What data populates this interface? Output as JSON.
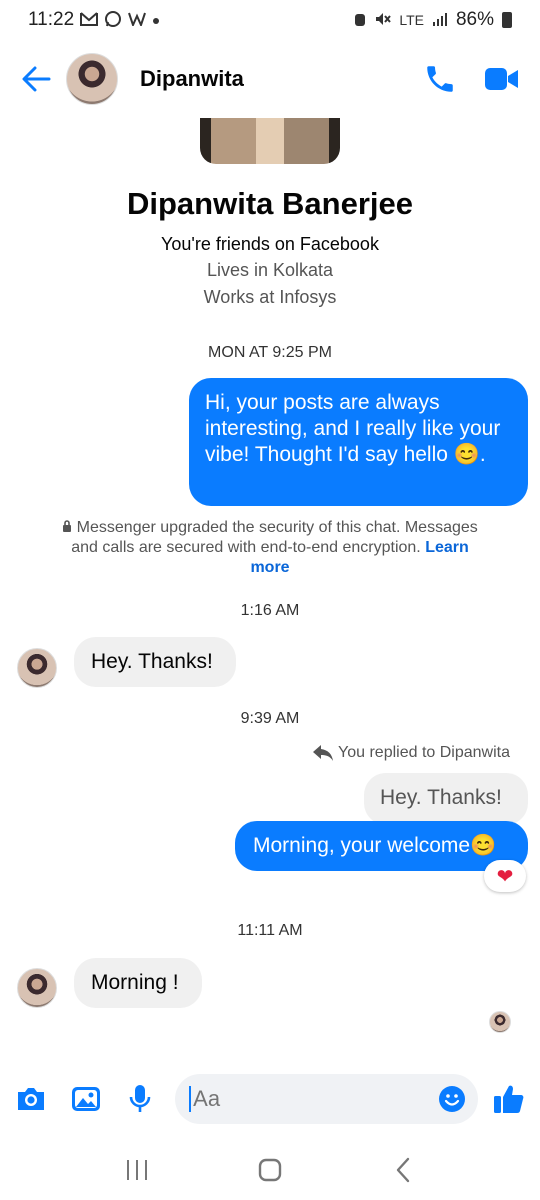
{
  "status_bar": {
    "time": "11:22",
    "left_icons": [
      "gmail-icon",
      "whatsapp-icon",
      "w-icon",
      "dot-icon"
    ],
    "right_text": "86%",
    "network": "LTE"
  },
  "header": {
    "contact_name": "Dipanwita"
  },
  "profile": {
    "full_name": "Dipanwita Banerjee",
    "friends_line": "You're friends on Facebook",
    "lives_line": "Lives in Kolkata",
    "works_line": "Works at Infosys"
  },
  "conversation": {
    "ts1": "MON AT 9:25 PM",
    "msg1": "Hi, your posts are always interesting, and I really like your vibe! Thought I'd say hello 😊.",
    "security_text": "Messenger upgraded the security of this chat. Messages and calls are secured with end-to-end encryption.",
    "learn_more": "Learn more",
    "ts2": "1:16 AM",
    "msg2": "Hey. Thanks!",
    "ts3": "9:39 AM",
    "reply_note": "You replied to Dipanwita",
    "quoted": "Hey. Thanks!",
    "msg3": "Morning, your welcome😊",
    "reaction": "❤",
    "ts4": "11:11 AM",
    "msg4": "Morning !"
  },
  "composer": {
    "placeholder": "Aa"
  },
  "colors": {
    "accent": "#0a7cff",
    "incoming_bubble": "#f0f0f0",
    "reaction_heart": "#e41e3f"
  }
}
